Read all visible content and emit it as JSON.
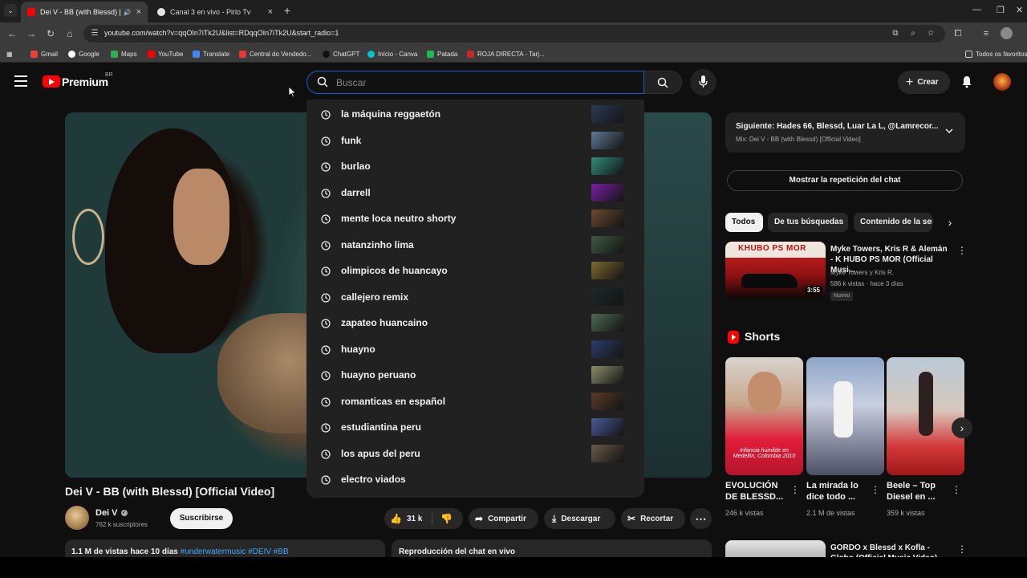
{
  "browser": {
    "tabs": [
      {
        "title": "Dei V - BB (with Blessd) [Of",
        "active": true
      },
      {
        "title": "Canal 3 en vivo - Pirlo Tv",
        "active": false
      }
    ],
    "url": "youtube.com/watch?v=qqOIn7iTk2U&list=RDqqOIn7iTk2U&start_radio=1",
    "bookmarks": [
      "Gmail",
      "Google",
      "Maps",
      "YouTube",
      "Translate",
      "Central do Vendedo...",
      "ChatGPT",
      "Início - Canva",
      "Patada",
      "ROJA DIRECTA - Tarj..."
    ],
    "bookmarks_folder": "Todos os favoritos"
  },
  "masthead": {
    "brand": "Premium",
    "country": "BR",
    "search_placeholder": "Buscar",
    "create_label": "Crear"
  },
  "suggestions": [
    "la máquina reggaetón",
    "funk",
    "burlao",
    "darrell",
    "mente loca neutro shorty",
    "natanzinho lima",
    "olimpicos de huancayo",
    "callejero remix",
    "zapateo huancaino",
    "huayno",
    "huayno peruano",
    "romanticas en español",
    "estudiantina peru",
    "los apus del peru",
    "electro viados"
  ],
  "video": {
    "title": "Dei V - BB (with Blessd) [Official Video]",
    "channel": "Dei V",
    "subscribers": "762 k suscriptores",
    "subscribe_label": "Suscribirse",
    "likes": "31 k",
    "share_label": "Compartir",
    "download_label": "Descargar",
    "clip_label": "Recortar",
    "views_date": "1.1 M de vistas  hace 10 días",
    "hashtags": "#underwatermusic #DEIV #BB",
    "chat_replay_title": "Reproducción del chat en vivo"
  },
  "sidebar": {
    "next_line": "Siguiente: Hades 66, Blessd, Luar La L, @Lamrecor...",
    "mix_line": "Mix: Dei V - BB (with Blessd) [Official Video]",
    "chat_replay_button": "Mostrar la repetición del chat",
    "chips": [
      "Todos",
      "De tus búsquedas",
      "Contenido de la ser"
    ],
    "rec": {
      "title": "Myke Towers, Kris R & Alemán - K HUBO PS MOR (Official Musi...",
      "channel": "Myke Towers y Kris R.",
      "stats": "586 k vistas · hace 3 días",
      "badge": "Nuevo",
      "duration": "3:55",
      "thumb_text": "KHUBO PS MOR"
    },
    "shorts_heading": "Shorts",
    "shorts": [
      {
        "title": "EVOLUCIÓN DE BLESSD...",
        "views": "246 k vistas",
        "caption": "Infancia humilde en Medellín, Colombia 2010"
      },
      {
        "title": "La mirada lo dice todo ...",
        "views": "2.1 M de vistas",
        "caption": ""
      },
      {
        "title": "Beele – Top Diesel en ...",
        "views": "359 k vistas",
        "caption": ""
      }
    ],
    "rec2_title": "GORDO x Blessd x Kofla - Globo (Official Music Video)"
  }
}
